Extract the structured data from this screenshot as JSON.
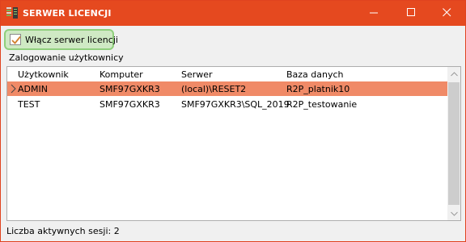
{
  "window": {
    "title": "SERWER LICENCJI",
    "accent_color": "#e5491f"
  },
  "titlebar_buttons": {
    "minimize_icon": "minimize-icon",
    "maximize_icon": "maximize-icon",
    "close_icon": "close-icon"
  },
  "license_toggle": {
    "label": "Włącz serwer licencji",
    "checked": true
  },
  "sessions_section": {
    "label": "Zalogowanie użytkownicy"
  },
  "table": {
    "columns": [
      "Użytkownik",
      "Komputer",
      "Serwer",
      "Baza danych"
    ],
    "rows": [
      {
        "user": "ADMIN",
        "computer": "SMF97GXKR3",
        "server": "(local)\\RESET2",
        "database": "R2P_platnik10",
        "selected": true
      },
      {
        "user": "TEST",
        "computer": "SMF97GXKR3",
        "server": "SMF97GXKR3\\SQL_2019",
        "database": "R2P_testowanie",
        "selected": false
      }
    ],
    "selection_color": "#f08a67"
  },
  "footer": {
    "active_sessions_text": "Liczba aktywnych sesji: 2"
  }
}
